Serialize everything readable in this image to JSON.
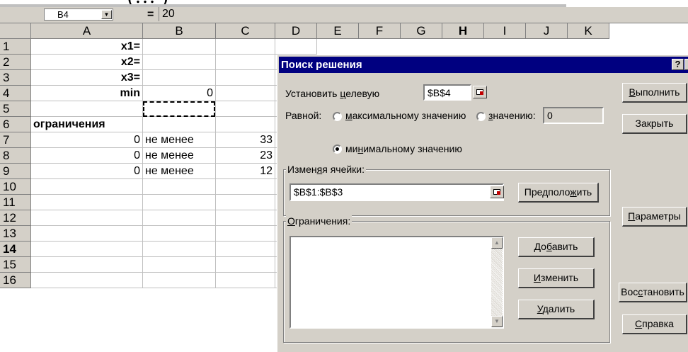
{
  "top_fragment": "(…       )",
  "formula_bar": {
    "name_box": "B4",
    "equals": "=",
    "formula": "20"
  },
  "columns": [
    "A",
    "B",
    "C",
    "D",
    "E",
    "F",
    "G",
    "H",
    "I",
    "J",
    "K"
  ],
  "rows": [
    "1",
    "2",
    "3",
    "4",
    "5",
    "6",
    "7",
    "8",
    "9",
    "10",
    "11",
    "12",
    "13",
    "14",
    "15",
    "16"
  ],
  "cells": {
    "A1": "x1=",
    "A2": "x2=",
    "A3": "x3=",
    "A4": "min",
    "B4": "0",
    "A6": "ограничения",
    "A7": "0",
    "B7": "не менее",
    "C7": "33",
    "A8": "0",
    "B8": "не менее",
    "C8": "23",
    "A9": "0",
    "B9": "не менее",
    "C9": "12"
  },
  "dialog": {
    "title": "Поиск решения",
    "help_glyph": "?",
    "close_glyph": "×",
    "target_label_pre": "Установить ",
    "target_label_key": "ц",
    "target_label_post": "елевую",
    "target_value": "$B$4",
    "equal_label": "Равной:",
    "max_pre": "",
    "max_key": "м",
    "max_post": "аксимальному значению",
    "val_pre": "",
    "val_key": "з",
    "val_post": "начению:",
    "value_field": "0",
    "min_pre": "ми",
    "min_key": "н",
    "min_post": "имальному значению",
    "changing_pre": "Измен",
    "changing_key": "я",
    "changing_post": "я ячейки:",
    "changing_value": "$B$1:$B$3",
    "guess_pre": "Предполо",
    "guess_key": "ж",
    "guess_post": "ить",
    "constraints_pre": "",
    "constraints_key": "О",
    "constraints_post": "граничения:",
    "add_pre": "До",
    "add_key": "б",
    "add_post": "авить",
    "change_pre": "",
    "change_key": "И",
    "change_post": "зменить",
    "delete_pre": "",
    "delete_key": "У",
    "delete_post": "далить",
    "run_pre": "",
    "run_key": "В",
    "run_post": "ыполнить",
    "close_label": "Закрыть",
    "params_pre": "",
    "params_key": "П",
    "params_post": "араметры",
    "reset_pre": "Вос",
    "reset_key": "с",
    "reset_post": "тановить",
    "help_pre": "",
    "help_key": "С",
    "help_post": "правка"
  }
}
